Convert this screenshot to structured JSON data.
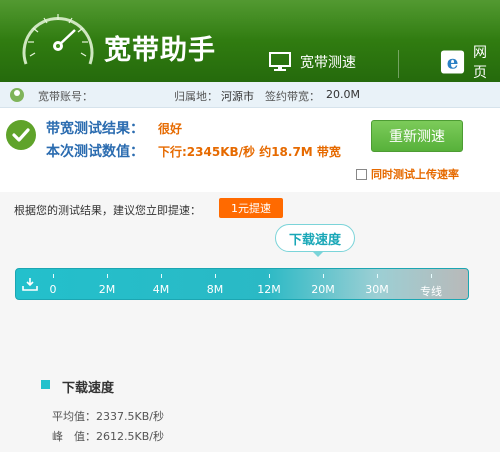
{
  "app": {
    "title": "宽带助手"
  },
  "nav": {
    "speed_label": "宽带测速",
    "web_label": "网页"
  },
  "account": {
    "account_label": "宽带账号：",
    "region_label": "归属地：",
    "region_value": "河源市",
    "bandwidth_label": "签约带宽：",
    "bandwidth_value": "20.0M"
  },
  "result": {
    "result_label": "带宽测试结果：",
    "result_value": "很好",
    "current_label": "本次测试数值：",
    "current_value": "下行:2345KB/秒 约18.7M 带宽",
    "retest_label": "重新测速",
    "upload_label": "同时测试上传速率",
    "upload_checked": false
  },
  "suggestion": {
    "text": "根据您的测试结果，建议您立即提速：",
    "promo_label": "1元提速"
  },
  "meter": {
    "bubble_label": "下载速度",
    "ticks": [
      "0",
      "2M",
      "4M",
      "8M",
      "12M",
      "20M",
      "30M",
      "专线"
    ]
  },
  "stats": {
    "title": "下载速度",
    "avg_label": "平均值：",
    "avg_value": "2337.5KB/秒",
    "peak_label": "峰　值：",
    "peak_value": "2612.5KB/秒"
  },
  "colors": {
    "brand_green": "#2f7a10",
    "accent_orange": "#e66a00",
    "meter_teal": "#23c0cc",
    "link_blue": "#2b6cb0"
  },
  "icons": {
    "gauge": "speedometer-icon",
    "monitor": "monitor-icon",
    "browser": "ie-browser-icon",
    "user": "user-icon",
    "ok": "check-icon",
    "download": "download-icon"
  }
}
